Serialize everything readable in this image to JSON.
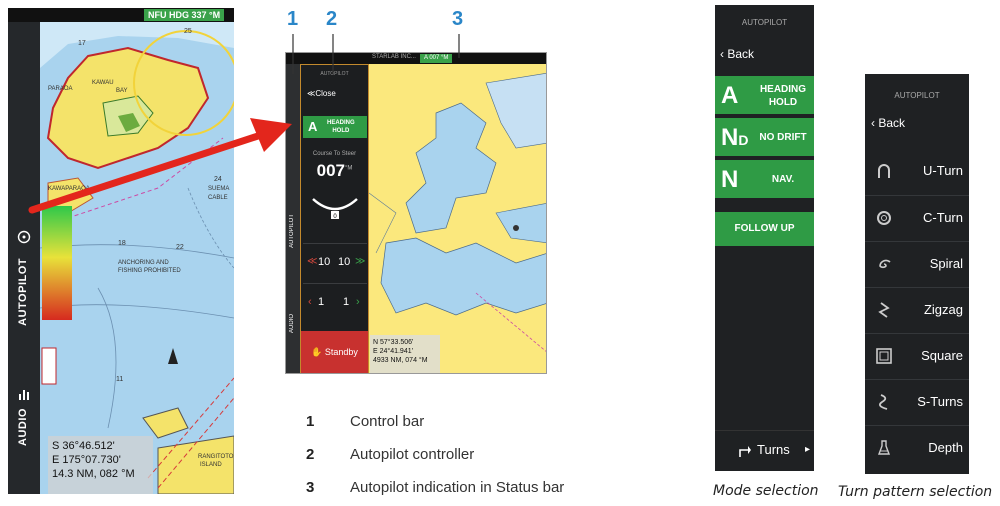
{
  "left_map": {
    "heading_badge": "NFU HDG 337 °M",
    "control_bar": {
      "autopilot_label": "AUTOPILOT",
      "audio_label": "AUDIO"
    },
    "position": {
      "lat": "S 36°46.512'",
      "lon": "E 175°07.730'",
      "range": "14.3 NM, 082 °M"
    },
    "chart_labels": {
      "depth_17": "17",
      "depth_25": "25",
      "label_kawau": "KAWAU",
      "label_bay": "BAY",
      "label_paraoa": "PARAOA",
      "label_kawaparaoa": "KAWAPARAOA",
      "depth_24": "24",
      "label_suema": "SUEMA",
      "label_cable": "CABLE",
      "depth_22": "22",
      "depth_18": "18",
      "label_anchoring": "ANCHORING AND",
      "label_fishing": "FISHING PROHIBITED",
      "depth_11": "11",
      "label_rangitoto": "RANGITOTO",
      "label_island": "ISLAND"
    }
  },
  "center_screen": {
    "status_text": "STARLAB INC...",
    "heading_badge": "A 007 °M",
    "controller_title": "AUTOPILOT",
    "close_label": "≪Close",
    "mode_letter": "A",
    "mode_label_line1": "HEADING",
    "mode_label_line2": "HOLD",
    "course_to_steer_label": "Course To Steer",
    "course_value": "007",
    "course_unit": "°M",
    "rudder_value": "0",
    "row1_left": "10",
    "row1_right": "10",
    "row2_left": "1",
    "row2_right": "1",
    "standby_label": "Standby",
    "strip_autopilot": "AUTOPILOT",
    "strip_audio": "AUDIO",
    "position": {
      "lat": "N 57°33.506'",
      "lon": "E 24°41.941'",
      "range": "4933 NM, 074 °M"
    }
  },
  "callouts": [
    "1",
    "2",
    "3"
  ],
  "legend": [
    {
      "num": "1",
      "text": "Control bar"
    },
    {
      "num": "2",
      "text": "Autopilot controller"
    },
    {
      "num": "3",
      "text": "Autopilot indication in Status bar"
    }
  ],
  "mode_panel": {
    "title": "AUTOPILOT",
    "back_label": "Back",
    "modes": [
      {
        "letter": "A",
        "sub": "",
        "line1": "HEADING",
        "line2": "HOLD"
      },
      {
        "letter": "N",
        "sub": "D",
        "line1": "NO DRIFT",
        "line2": ""
      },
      {
        "letter": "N",
        "sub": "",
        "line1": "NAV.",
        "line2": ""
      }
    ],
    "follow_up_label": "FOLLOW UP",
    "turns_label": "Turns",
    "caption": "Mode selection",
    "accent_color": "#2f9b45"
  },
  "turn_panel": {
    "title": "AUTOPILOT",
    "back_label": "Back",
    "items": [
      {
        "label": "U-Turn",
        "icon": "u-turn-icon"
      },
      {
        "label": "C-Turn",
        "icon": "c-turn-icon"
      },
      {
        "label": "Spiral",
        "icon": "spiral-icon"
      },
      {
        "label": "Zigzag",
        "icon": "zigzag-icon"
      },
      {
        "label": "Square",
        "icon": "square-icon"
      },
      {
        "label": "S-Turns",
        "icon": "s-turns-icon"
      },
      {
        "label": "Depth",
        "icon": "depth-icon"
      }
    ],
    "caption": "Turn pattern selection"
  }
}
